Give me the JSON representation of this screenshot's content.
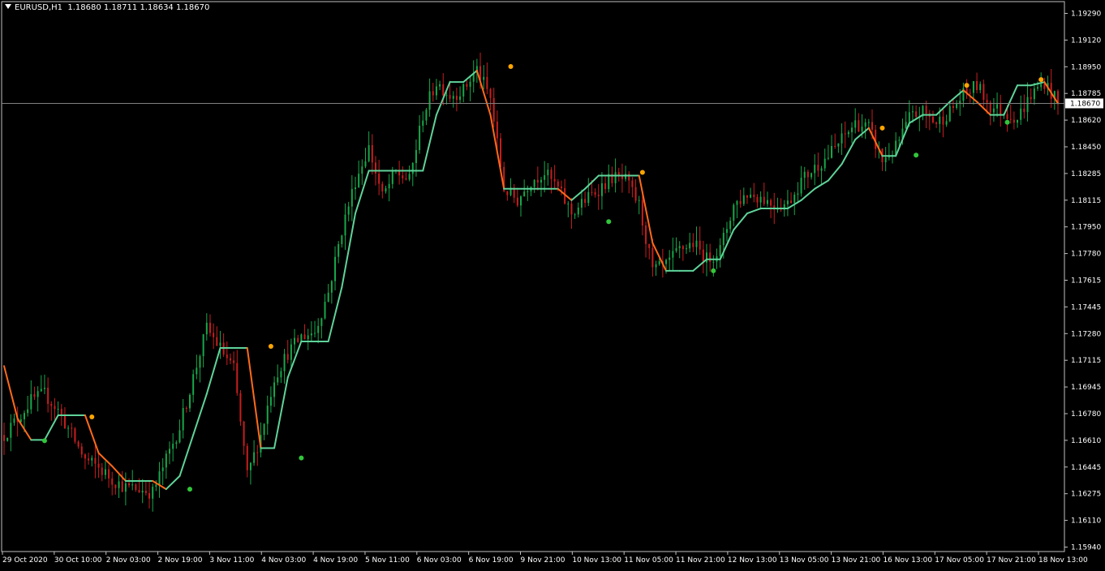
{
  "header": {
    "symbol": "EURUSD,H1",
    "ohlc": "1.18680 1.18711 1.18634 1.18670"
  },
  "colors": {
    "background": "#000000",
    "frame": "#C0C0C0",
    "bull_candle": "#17A84A",
    "bear_candle": "#C81E1E",
    "trend_up": "#5FD39A",
    "trend_down": "#FF6A1A",
    "dot_up": "#31C63A",
    "dot_down": "#FFA500",
    "price_line": "#808080",
    "text": "#FFFFFF"
  },
  "chart_data": {
    "type": "line",
    "subtype": "candlestick chart with trend-line indicator",
    "title": "EURUSD,H1",
    "x_tick_labels": [
      "29 Oct 2020",
      "30 Oct 10:00",
      "2 Nov 03:00",
      "2 Nov 19:00",
      "3 Nov 11:00",
      "4 Nov 03:00",
      "4 Nov 19:00",
      "5 Nov 11:00",
      "6 Nov 03:00",
      "6 Nov 19:00",
      "9 Nov 21:00",
      "10 Nov 13:00",
      "11 Nov 05:00",
      "11 Nov 21:00",
      "12 Nov 13:00",
      "13 Nov 05:00",
      "13 Nov 21:00",
      "16 Nov 13:00",
      "17 Nov 05:00",
      "17 Nov 21:00",
      "18 Nov 13:00"
    ],
    "y_tick_labels": [
      "1.19290",
      "1.19120",
      "1.18950",
      "1.18785",
      "1.18620",
      "1.18450",
      "1.18285",
      "1.18115",
      "1.17950",
      "1.17780",
      "1.17615",
      "1.17445",
      "1.17280",
      "1.17115",
      "1.16945",
      "1.16780",
      "1.16610",
      "1.16445",
      "1.16275",
      "1.16110",
      "1.15940"
    ],
    "ylim": [
      1.1594,
      1.1929
    ],
    "current_price": 1.1867,
    "current_price_label": "1.18670",
    "grid": false,
    "series": [
      {
        "kind": "close_price",
        "x": [
          0,
          4,
          8,
          12,
          16,
          20,
          24,
          28,
          32,
          36,
          40,
          44,
          48,
          52,
          56,
          60,
          64,
          68,
          72,
          76,
          80,
          84,
          88,
          92,
          96,
          100,
          104,
          108,
          112,
          116,
          120,
          124,
          128,
          132,
          136,
          140,
          144,
          148,
          152,
          156,
          160,
          164,
          168,
          172,
          176,
          180,
          184,
          188,
          192,
          196,
          200,
          204,
          208,
          212,
          216,
          220,
          224,
          228,
          232,
          236,
          240,
          244,
          248,
          252,
          256,
          260,
          264,
          268,
          272,
          276,
          280,
          284,
          288,
          292,
          296,
          300,
          304,
          308,
          312
        ],
        "y": [
          1.1665,
          1.1675,
          1.1686,
          1.169,
          1.168,
          1.1665,
          1.165,
          1.1645,
          1.1638,
          1.1633,
          1.1632,
          1.163,
          1.165,
          1.167,
          1.17,
          1.173,
          1.1718,
          1.1705,
          1.164,
          1.1665,
          1.17,
          1.1715,
          1.1725,
          1.1728,
          1.1752,
          1.179,
          1.182,
          1.184,
          1.181,
          1.1825,
          1.182,
          1.186,
          1.188,
          1.1872,
          1.1875,
          1.1888,
          1.187,
          1.1815,
          1.1808,
          1.182,
          1.1825,
          1.1815,
          1.18,
          1.1808,
          1.1815,
          1.1822,
          1.182,
          1.1805,
          1.1765,
          1.1768,
          1.1778,
          1.1782,
          1.1772,
          1.1778,
          1.1805,
          1.1812,
          1.181,
          1.1805,
          1.1806,
          1.182,
          1.1828,
          1.1835,
          1.1845,
          1.1855,
          1.1852,
          1.1832,
          1.184,
          1.1858,
          1.1862,
          1.1855,
          1.1862,
          1.1872,
          1.1878,
          1.1865,
          1.1862,
          1.1858,
          1.1872,
          1.188,
          1.1867
        ]
      },
      {
        "kind": "trend_line",
        "x": [
          0,
          4,
          8,
          12,
          16,
          20,
          24,
          28,
          32,
          36,
          40,
          44,
          48,
          52,
          56,
          60,
          64,
          68,
          72,
          76,
          80,
          84,
          88,
          92,
          96,
          100,
          104,
          108,
          112,
          116,
          120,
          124,
          128,
          132,
          136,
          140,
          144,
          148,
          152,
          156,
          160,
          164,
          168,
          172,
          176,
          180,
          184,
          188,
          192,
          196,
          200,
          204,
          208,
          212,
          216,
          220,
          224,
          228,
          232,
          236,
          240,
          244,
          248,
          252,
          256,
          260,
          264,
          268,
          272,
          276,
          280,
          284,
          288,
          292,
          296,
          300,
          304,
          308,
          312
        ],
        "y": [
          1.1707,
          1.1675,
          1.1662,
          1.1662,
          1.1677,
          1.1677,
          1.1677,
          1.1654,
          1.1646,
          1.1637,
          1.1637,
          1.1637,
          1.1632,
          1.164,
          1.1665,
          1.169,
          1.1718,
          1.1718,
          1.1718,
          1.1657,
          1.1657,
          1.17,
          1.1722,
          1.1722,
          1.1722,
          1.1755,
          1.18,
          1.1826,
          1.1826,
          1.1826,
          1.1826,
          1.1826,
          1.186,
          1.188,
          1.188,
          1.1887,
          1.186,
          1.1815,
          1.1815,
          1.1815,
          1.1815,
          1.1815,
          1.1808,
          1.1815,
          1.1823,
          1.1823,
          1.1823,
          1.1823,
          1.1782,
          1.1765,
          1.1765,
          1.1765,
          1.1772,
          1.1772,
          1.179,
          1.18,
          1.1803,
          1.1803,
          1.1803,
          1.1808,
          1.1815,
          1.182,
          1.183,
          1.1845,
          1.1852,
          1.1835,
          1.1835,
          1.1855,
          1.186,
          1.186,
          1.1868,
          1.1875,
          1.1868,
          1.186,
          1.186,
          1.1878,
          1.1878,
          1.188,
          1.1867
        ]
      }
    ],
    "dots_up": [
      [
        12,
        1.16615
      ],
      [
        55,
        1.1632
      ],
      [
        88,
        1.1651
      ],
      [
        179,
        1.1795
      ],
      [
        210,
        1.1765
      ],
      [
        270,
        1.18355
      ],
      [
        297,
        1.18555
      ]
    ],
    "dots_down": [
      [
        26,
        1.1676
      ],
      [
        79,
        1.1719
      ],
      [
        150,
        1.18895
      ],
      [
        189,
        1.1825
      ],
      [
        260,
        1.1852
      ],
      [
        285,
        1.1878
      ],
      [
        307,
        1.18815
      ]
    ]
  }
}
